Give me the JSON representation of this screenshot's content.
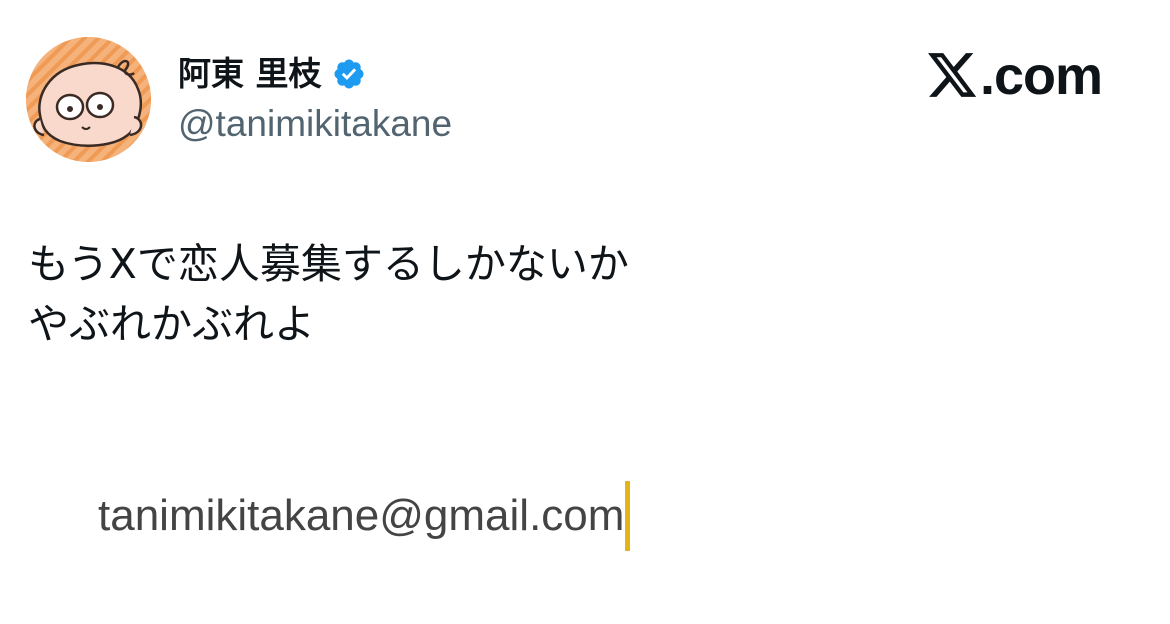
{
  "author": {
    "display_name": "阿東 里枝",
    "handle": "@tanimikitakane",
    "verified": true,
    "avatar_icon": "cartoon-face-avatar"
  },
  "brand": {
    "label": ".com",
    "logo_icon": "x-logo-icon"
  },
  "tweet": {
    "lines": [
      "もうXで恋人募集するしかないか",
      "やぶれかぶれよ"
    ]
  },
  "email_field": {
    "value": "tanimikitakane@gmail.com"
  },
  "colors": {
    "text": "#0f1419",
    "handle": "#536471",
    "verified": "#1d9bf0",
    "cursor": "#e5b418",
    "email_text": "#444444"
  }
}
